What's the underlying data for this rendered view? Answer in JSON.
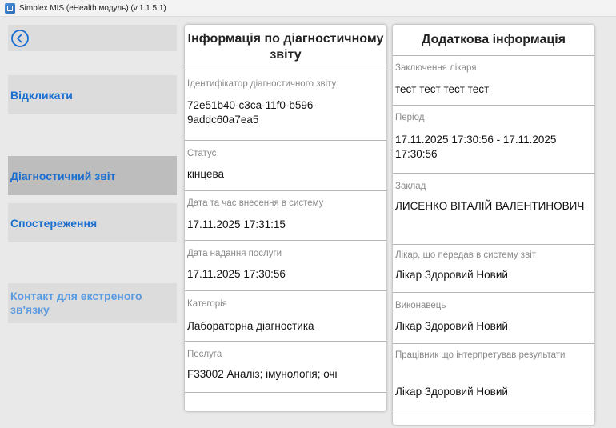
{
  "window": {
    "title": "Simplex MIS (eHealth модуль) (v.1.1.5.1)"
  },
  "sidebar": {
    "back_icon": "arrow-left-circle-icon",
    "items": [
      {
        "label": "Відкликати"
      },
      {
        "label": "Діагностичний звіт"
      },
      {
        "label": "Спостереження"
      },
      {
        "label": "Контакт для екстреного зв'язку"
      }
    ]
  },
  "report": {
    "title": "Інформація по діагностичному звіту",
    "fields": [
      {
        "label": "Ідентифікатор діагностичного звіту",
        "value": "72e51b40-c3ca-11f0-b596-9addc60a7ea5"
      },
      {
        "label": "Статус",
        "value": "кінцева"
      },
      {
        "label": "Дата та час внесення в систему",
        "value": "17.11.2025 17:31:15"
      },
      {
        "label": "Дата надання послуги",
        "value": "17.11.2025 17:30:56"
      },
      {
        "label": "Категорія",
        "value": "Лабораторна діагностика"
      },
      {
        "label": "Послуга",
        "value": "F33002 Аналіз; імунологія; очі"
      }
    ]
  },
  "additional": {
    "title": "Додаткова інформація",
    "fields": [
      {
        "label": "Заключення лікаря",
        "value": "тест тест тест тест"
      },
      {
        "label": "Період",
        "value": "17.11.2025 17:30:56 - 17.11.2025 17:30:56"
      },
      {
        "label": "Заклад",
        "value": "ЛИСЕНКО ВІТАЛІЙ ВАЛЕНТИНОВИЧ"
      },
      {
        "label": "Лікар, що передав в систему звіт",
        "value": "Лікар Здоровий Новий"
      },
      {
        "label": "Виконавець",
        "value": "Лікар Здоровий Новий"
      },
      {
        "label": "Працівник що інтерпретував результати",
        "value": "Лікар Здоровий Новий"
      }
    ]
  },
  "colors": {
    "accent": "#1a6ed0",
    "active_nav": "#bdbdbd",
    "nav_bg": "#dcdcdc",
    "window_bg": "#e9e9e9"
  }
}
